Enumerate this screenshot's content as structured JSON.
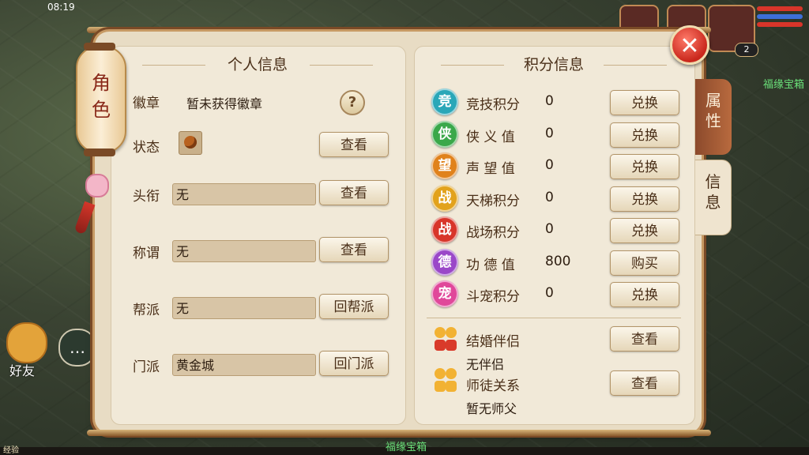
{
  "status_bar": {
    "time": "08:19"
  },
  "hud": {
    "level": "2",
    "right_label": "福缘宝箱"
  },
  "lantern": {
    "text_1": "角",
    "text_2": "色"
  },
  "left_hud": {
    "friends_label": "好友",
    "chat_icon": "chat-icon"
  },
  "bottom": {
    "exp_label": "经验",
    "center_label": "福缘宝箱"
  },
  "close_icon": "close-icon",
  "personal": {
    "title": "个人信息",
    "badge_label": "徽章",
    "badge_value": "暂未获得徽章",
    "help_icon": "?",
    "state_label": "状态",
    "state_view_btn": "查看",
    "title_label": "头衔",
    "title_value": "无",
    "title_view_btn": "查看",
    "appellation_label": "称谓",
    "appellation_value": "无",
    "appellation_view_btn": "查看",
    "guild_label": "帮派",
    "guild_value": "无",
    "guild_btn": "回帮派",
    "sect_label": "门派",
    "sect_value": "黄金城",
    "sect_btn": "回门派"
  },
  "points": {
    "title": "积分信息",
    "items": [
      {
        "icon": "竞",
        "name": "竞技积分",
        "value": "0",
        "btn": "兑换",
        "color": "#2aa7b8"
      },
      {
        "icon": "侠",
        "name": "侠 义 值",
        "value": "0",
        "btn": "兑换",
        "color": "#3aa84a"
      },
      {
        "icon": "望",
        "name": "声 望 值",
        "value": "0",
        "btn": "兑换",
        "color": "#e0821c"
      },
      {
        "icon": "战",
        "name": "天梯积分",
        "value": "0",
        "btn": "兑换",
        "color": "#e2a21c"
      },
      {
        "icon": "战",
        "name": "战场积分",
        "value": "0",
        "btn": "兑换",
        "color": "#d8352a"
      },
      {
        "icon": "德",
        "name": "功 德 值",
        "value": "800",
        "btn": "购买",
        "color": "#9a48c8"
      },
      {
        "icon": "宠",
        "name": "斗宠积分",
        "value": "0",
        "btn": "兑换",
        "color": "#e0489a"
      }
    ],
    "marriage_label": "结婚伴侣",
    "marriage_btn": "查看",
    "marriage_value": "无伴侣",
    "mentor_label": "师徒关系",
    "mentor_btn": "查看",
    "mentor_value": "暂无师父"
  },
  "tabs": {
    "attr": "属性",
    "info": "信息"
  }
}
